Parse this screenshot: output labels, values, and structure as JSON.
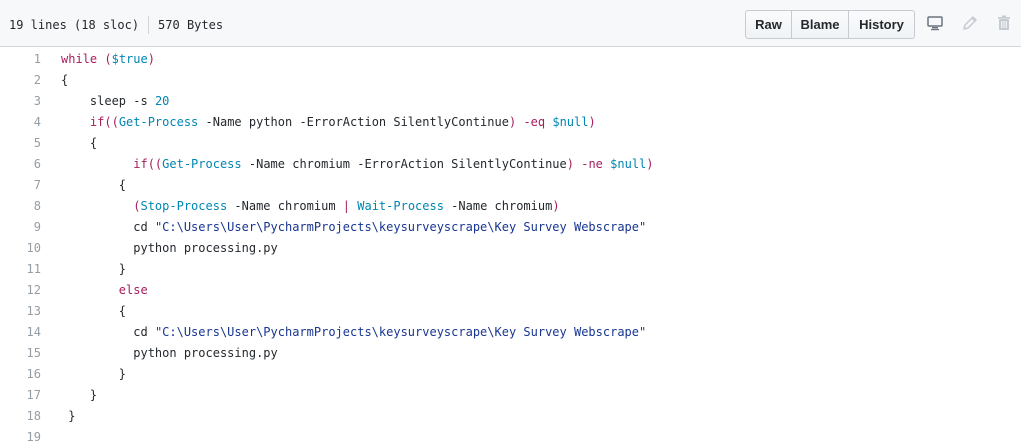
{
  "file_header": {
    "lines_info": "19 lines (18 sloc)",
    "size_info": "570 Bytes",
    "buttons": {
      "raw": "Raw",
      "blame": "Blame",
      "history": "History"
    },
    "icons": [
      "desktop-icon",
      "pencil-icon",
      "trash-icon"
    ]
  },
  "code": {
    "lines": [
      {
        "number": "1",
        "indent": "",
        "tokens": [
          {
            "t": "while",
            "c": "tok-kw"
          },
          {
            "t": " "
          },
          {
            "t": "(",
            "c": "tok-paren"
          },
          {
            "t": "$true",
            "c": "tok-var"
          },
          {
            "t": ")",
            "c": "tok-paren"
          }
        ]
      },
      {
        "number": "2",
        "indent": "",
        "tokens": [
          {
            "t": "{"
          }
        ]
      },
      {
        "number": "3",
        "indent": "    ",
        "tokens": [
          {
            "t": "sleep -s "
          },
          {
            "t": "20",
            "c": "tok-num"
          }
        ]
      },
      {
        "number": "4",
        "indent": "    ",
        "tokens": [
          {
            "t": "if",
            "c": "tok-kw"
          },
          {
            "t": "((",
            "c": "tok-paren"
          },
          {
            "t": "Get-Process",
            "c": "tok-cmd"
          },
          {
            "t": " -Name python -ErrorAction SilentlyContinue"
          },
          {
            "t": ")",
            "c": "tok-paren"
          },
          {
            "t": " "
          },
          {
            "t": "-eq",
            "c": "tok-op"
          },
          {
            "t": " "
          },
          {
            "t": "$null",
            "c": "tok-var"
          },
          {
            "t": ")",
            "c": "tok-paren"
          }
        ]
      },
      {
        "number": "5",
        "indent": "    ",
        "tokens": [
          {
            "t": "{"
          }
        ]
      },
      {
        "number": "6",
        "indent": "          ",
        "tokens": [
          {
            "t": "if",
            "c": "tok-kw"
          },
          {
            "t": "((",
            "c": "tok-paren"
          },
          {
            "t": "Get-Process",
            "c": "tok-cmd"
          },
          {
            "t": " -Name chromium -ErrorAction SilentlyContinue"
          },
          {
            "t": ")",
            "c": "tok-paren"
          },
          {
            "t": " "
          },
          {
            "t": "-ne",
            "c": "tok-op"
          },
          {
            "t": " "
          },
          {
            "t": "$null",
            "c": "tok-var"
          },
          {
            "t": ")",
            "c": "tok-paren"
          }
        ]
      },
      {
        "number": "7",
        "indent": "        ",
        "tokens": [
          {
            "t": "{"
          }
        ]
      },
      {
        "number": "8",
        "indent": "          ",
        "tokens": [
          {
            "t": "(",
            "c": "tok-paren"
          },
          {
            "t": "Stop-Process",
            "c": "tok-cmd"
          },
          {
            "t": " -Name chromium "
          },
          {
            "t": "|",
            "c": "tok-op"
          },
          {
            "t": " "
          },
          {
            "t": "Wait-Process",
            "c": "tok-cmd"
          },
          {
            "t": " -Name chromium"
          },
          {
            "t": ")",
            "c": "tok-paren"
          }
        ]
      },
      {
        "number": "9",
        "indent": "          ",
        "tokens": [
          {
            "t": "cd "
          },
          {
            "t": "\"C:\\Users\\User\\PycharmProjects\\keysurveyscrape\\Key Survey Webscrape\"",
            "c": "tok-str"
          }
        ]
      },
      {
        "number": "10",
        "indent": "          ",
        "tokens": [
          {
            "t": "python processing.py"
          }
        ]
      },
      {
        "number": "11",
        "indent": "        ",
        "tokens": [
          {
            "t": "}"
          }
        ]
      },
      {
        "number": "12",
        "indent": "        ",
        "tokens": [
          {
            "t": "else",
            "c": "tok-kw"
          }
        ]
      },
      {
        "number": "13",
        "indent": "        ",
        "tokens": [
          {
            "t": "{"
          }
        ]
      },
      {
        "number": "14",
        "indent": "          ",
        "tokens": [
          {
            "t": "cd "
          },
          {
            "t": "\"C:\\Users\\User\\PycharmProjects\\keysurveyscrape\\Key Survey Webscrape\"",
            "c": "tok-str"
          }
        ]
      },
      {
        "number": "15",
        "indent": "          ",
        "tokens": [
          {
            "t": "python processing.py"
          }
        ]
      },
      {
        "number": "16",
        "indent": "        ",
        "tokens": [
          {
            "t": "}"
          }
        ]
      },
      {
        "number": "17",
        "indent": "    ",
        "tokens": [
          {
            "t": "}"
          }
        ]
      },
      {
        "number": "18",
        "indent": " ",
        "tokens": [
          {
            "t": "}"
          }
        ]
      },
      {
        "number": "19",
        "indent": "",
        "tokens": []
      }
    ]
  },
  "colors": {
    "keyword": "#a71d5d",
    "variable": "#0086b3",
    "string": "#183691",
    "text": "#24292e",
    "line_number": "#959da5"
  }
}
